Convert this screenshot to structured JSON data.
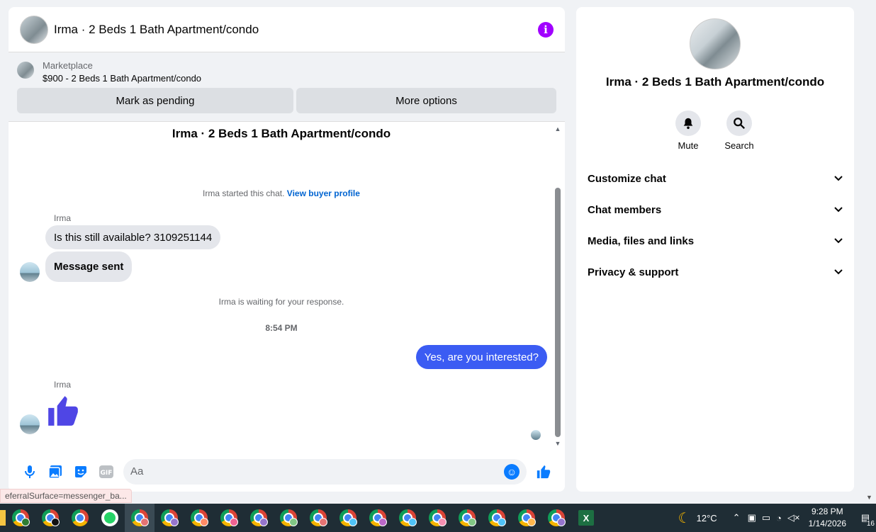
{
  "chat": {
    "title": "Irma · 2 Beds 1 Bath Apartment/condo",
    "marketplace_label": "Marketplace",
    "listing": "$900 - 2 Beds 1 Bath Apartment/condo",
    "mark_pending": "Mark as pending",
    "more_options": "More options",
    "thread_title": "Irma · 2 Beds 1 Bath Apartment/condo",
    "started_text": "Irma started this chat.",
    "view_profile": "View buyer profile",
    "messages": [
      {
        "sender": "Irma",
        "text": "Is this still available? 3109251144"
      },
      {
        "text": "Message sent"
      },
      {
        "text": "Yes, are you interested?"
      },
      {
        "sender": "Irma"
      }
    ],
    "waiting_text": "Irma is waiting for your response.",
    "timestamp": "8:54 PM",
    "placeholder": "Aa",
    "url_hint": "eferralSurface=messenger_ba..."
  },
  "info": {
    "title": "Irma · 2 Beds 1 Bath Apartment/condo",
    "mute": "Mute",
    "search": "Search",
    "sections": [
      "Customize chat",
      "Chat members",
      "Media, files and links",
      "Privacy & support"
    ]
  },
  "taskbar": {
    "temperature": "12°C",
    "time": "9:28 PM",
    "date": "1/14/2026",
    "notifications": "16"
  },
  "colors": {
    "accent": "#3b5cf3",
    "info_icon": "#a100ff",
    "link": "#0064d1",
    "like": "#4f46e5"
  }
}
